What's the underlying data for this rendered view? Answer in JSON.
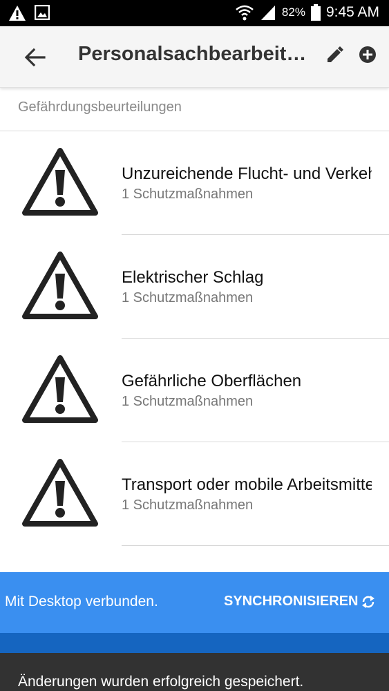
{
  "status_bar": {
    "battery_percent": "82%",
    "time": "9:45 AM",
    "icons": [
      "warning-icon",
      "image-icon",
      "wifi-icon",
      "signal-icon",
      "battery-icon"
    ]
  },
  "toolbar": {
    "title": "Personalsachbearbeit…",
    "icons": [
      "arrow-back-icon",
      "edit-pencil-icon",
      "add-circle-icon"
    ]
  },
  "section": {
    "header": "Gefährdungsbeurteilungen"
  },
  "items": [
    {
      "title": "Unzureichende Flucht- und Verkehrswege",
      "subtitle": "1 Schutzmaßnahmen",
      "icon": "warning-triangle-icon"
    },
    {
      "title": "Elektrischer Schlag",
      "subtitle": "1 Schutzmaßnahmen",
      "icon": "warning-triangle-icon"
    },
    {
      "title": "Gefährliche Oberflächen",
      "subtitle": "1 Schutzmaßnahmen",
      "icon": "warning-triangle-icon"
    },
    {
      "title": "Transport oder mobile Arbeitsmittel",
      "subtitle": "1 Schutzmaßnahmen",
      "icon": "warning-triangle-icon"
    }
  ],
  "sync_bar": {
    "message": "Mit Desktop verbunden.",
    "button_label": "SYNCHRONISIEREN",
    "icon": "sync-icon"
  },
  "snackbar": {
    "message": "Änderungen wurden erfolgreich gespeichert."
  },
  "colors": {
    "toolbar_bg": "#f5f5f5",
    "sync_bar_bg": "#3a8ff0",
    "bottom_strip_bg": "#1565c0",
    "snackbar_bg": "#323232"
  }
}
